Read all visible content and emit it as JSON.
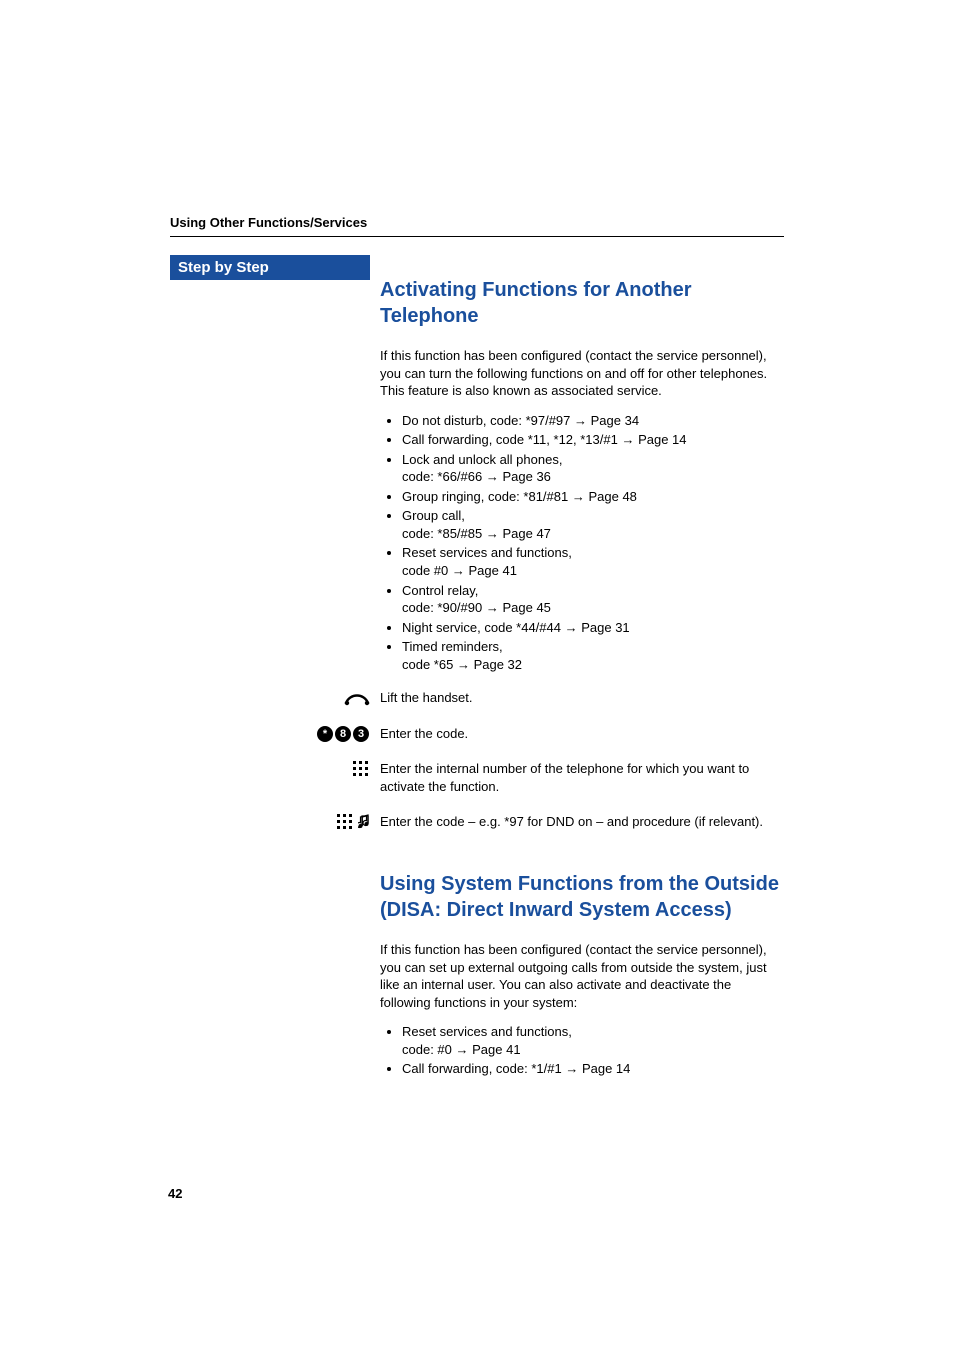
{
  "header_section": "Using Other Functions/Services",
  "sidebar": {
    "step_by_step": "Step by Step"
  },
  "section1": {
    "heading": "Activating Functions for Another Telephone",
    "intro": "If this function has been configured (contact the service personnel), you can turn the following functions on and off for other telephones. This feature is also known as associated service.",
    "bullets": [
      {
        "text": "Do not disturb, code: *97/#97 ",
        "link": "Page 34"
      },
      {
        "text": "Call forwarding, code *11, *12, *13/#1 ",
        "link": "Page 14"
      },
      {
        "text": "Lock and unlock all phones,\ncode: *66/#66 ",
        "link": "Page 36"
      },
      {
        "text": "Group ringing, code: *81/#81 ",
        "link": "Page 48"
      },
      {
        "text": "Group call,\ncode: *85/#85 ",
        "link": "Page 47"
      },
      {
        "text": "Reset services and functions,\ncode #0 ",
        "link": "Page 41"
      },
      {
        "text": "Control relay,\ncode: *90/#90 ",
        "link": "Page 45"
      },
      {
        "text": "Night service, code *44/#44 ",
        "link": "Page 31"
      },
      {
        "text": "Timed reminders,\ncode *65 ",
        "link": "Page 32"
      }
    ],
    "steps": [
      {
        "icon": "handset",
        "text": "Lift the handset."
      },
      {
        "icon": "code-83",
        "text": "Enter the code."
      },
      {
        "icon": "keypad",
        "text": "Enter the internal number of the telephone for which you want to activate the function."
      },
      {
        "icon": "keypad-tone",
        "text": "Enter the code – e.g. *97 for DND on – and procedure (if relevant)."
      }
    ]
  },
  "section2": {
    "heading": "Using System Functions from the Outside\n(DISA: Direct Inward System Access)",
    "intro": "If this function has been configured (contact the service personnel), you can set up external outgoing calls from outside the system, just like an internal user.  You can also activate and deactivate the following functions in your system:",
    "bullets": [
      {
        "text": "Reset services and functions,\ncode: #0 ",
        "link": "Page 41"
      },
      {
        "text": "Call forwarding, code: *1/#1 ",
        "link": "Page 14"
      }
    ]
  },
  "page_number": "42"
}
